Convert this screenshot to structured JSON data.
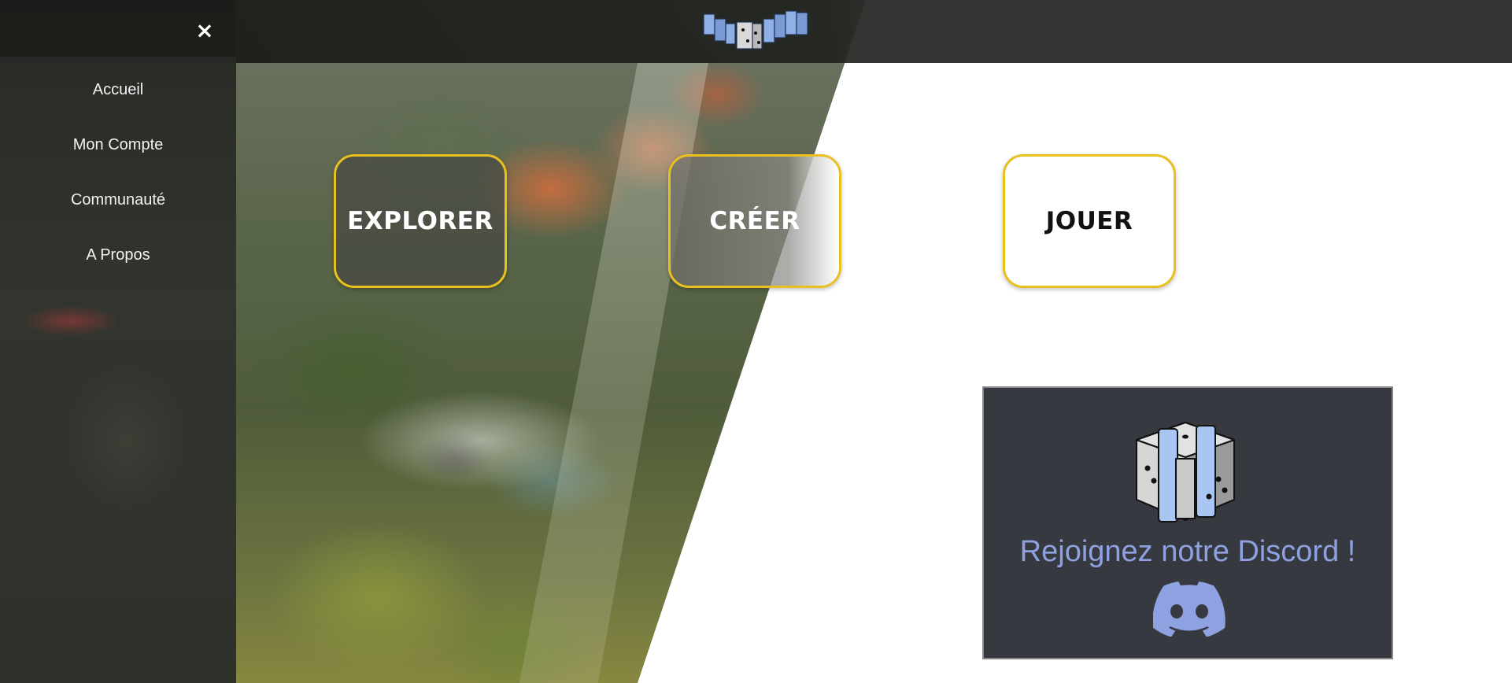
{
  "sidebar": {
    "close_label": "×",
    "items": [
      {
        "label": "Accueil"
      },
      {
        "label": "Mon Compte"
      },
      {
        "label": "Communauté"
      },
      {
        "label": "A Propos"
      }
    ]
  },
  "header": {
    "logo_icon": "dice-logo-icon"
  },
  "actions": {
    "explore_label": "EXPLORER",
    "create_label": "CRÉER",
    "play_label": "JOUER",
    "border_color": "#e8c01f"
  },
  "discord": {
    "text": "Rejoignez notre Discord !",
    "text_color": "#8ea1e1",
    "background": "#36393f",
    "icon": "discord-icon"
  }
}
